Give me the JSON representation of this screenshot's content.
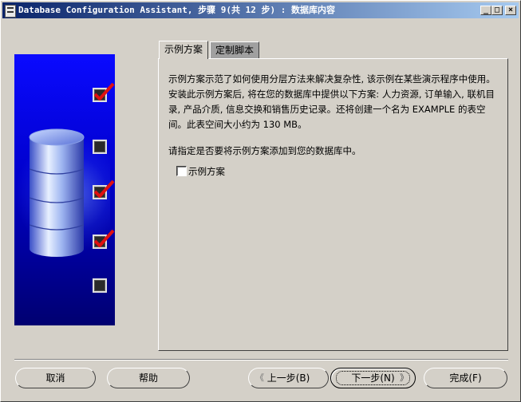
{
  "window": {
    "title": "Database Configuration Assistant, 步骤 9(共 12 步) : 数据库内容"
  },
  "titlebar_buttons": {
    "minimize": "_",
    "maximize": "□",
    "close": "×"
  },
  "steps": [
    {
      "checked": true
    },
    {
      "checked": false
    },
    {
      "checked": true
    },
    {
      "checked": true
    },
    {
      "checked": false
    }
  ],
  "tabs": [
    {
      "label": "示例方案",
      "active": true
    },
    {
      "label": "定制脚本",
      "active": false
    }
  ],
  "panel": {
    "description": "示例方案示范了如何使用分层方法来解决复杂性, 该示例在某些演示程序中使用。安装此示例方案后, 将在您的数据库中提供以下方案: 人力资源, 订单输入, 联机目录, 产品介质, 信息交换和销售历史记录。还将创建一个名为 EXAMPLE 的表空间。此表空间大小约为 130 MB。",
    "prompt": "请指定是否要将示例方案添加到您的数据库中。",
    "checkbox": {
      "label": "示例方案",
      "checked": false
    }
  },
  "buttons": {
    "cancel": "取消",
    "help": "帮助",
    "back": "上一步(B)",
    "next": "下一步(N)",
    "finish": "完成(F)"
  },
  "colors": {
    "title_bar_start": "#0a246a",
    "left_panel": "#0000cc",
    "check_mark": "#e01010",
    "dialog_bg": "#d4d0c8"
  }
}
